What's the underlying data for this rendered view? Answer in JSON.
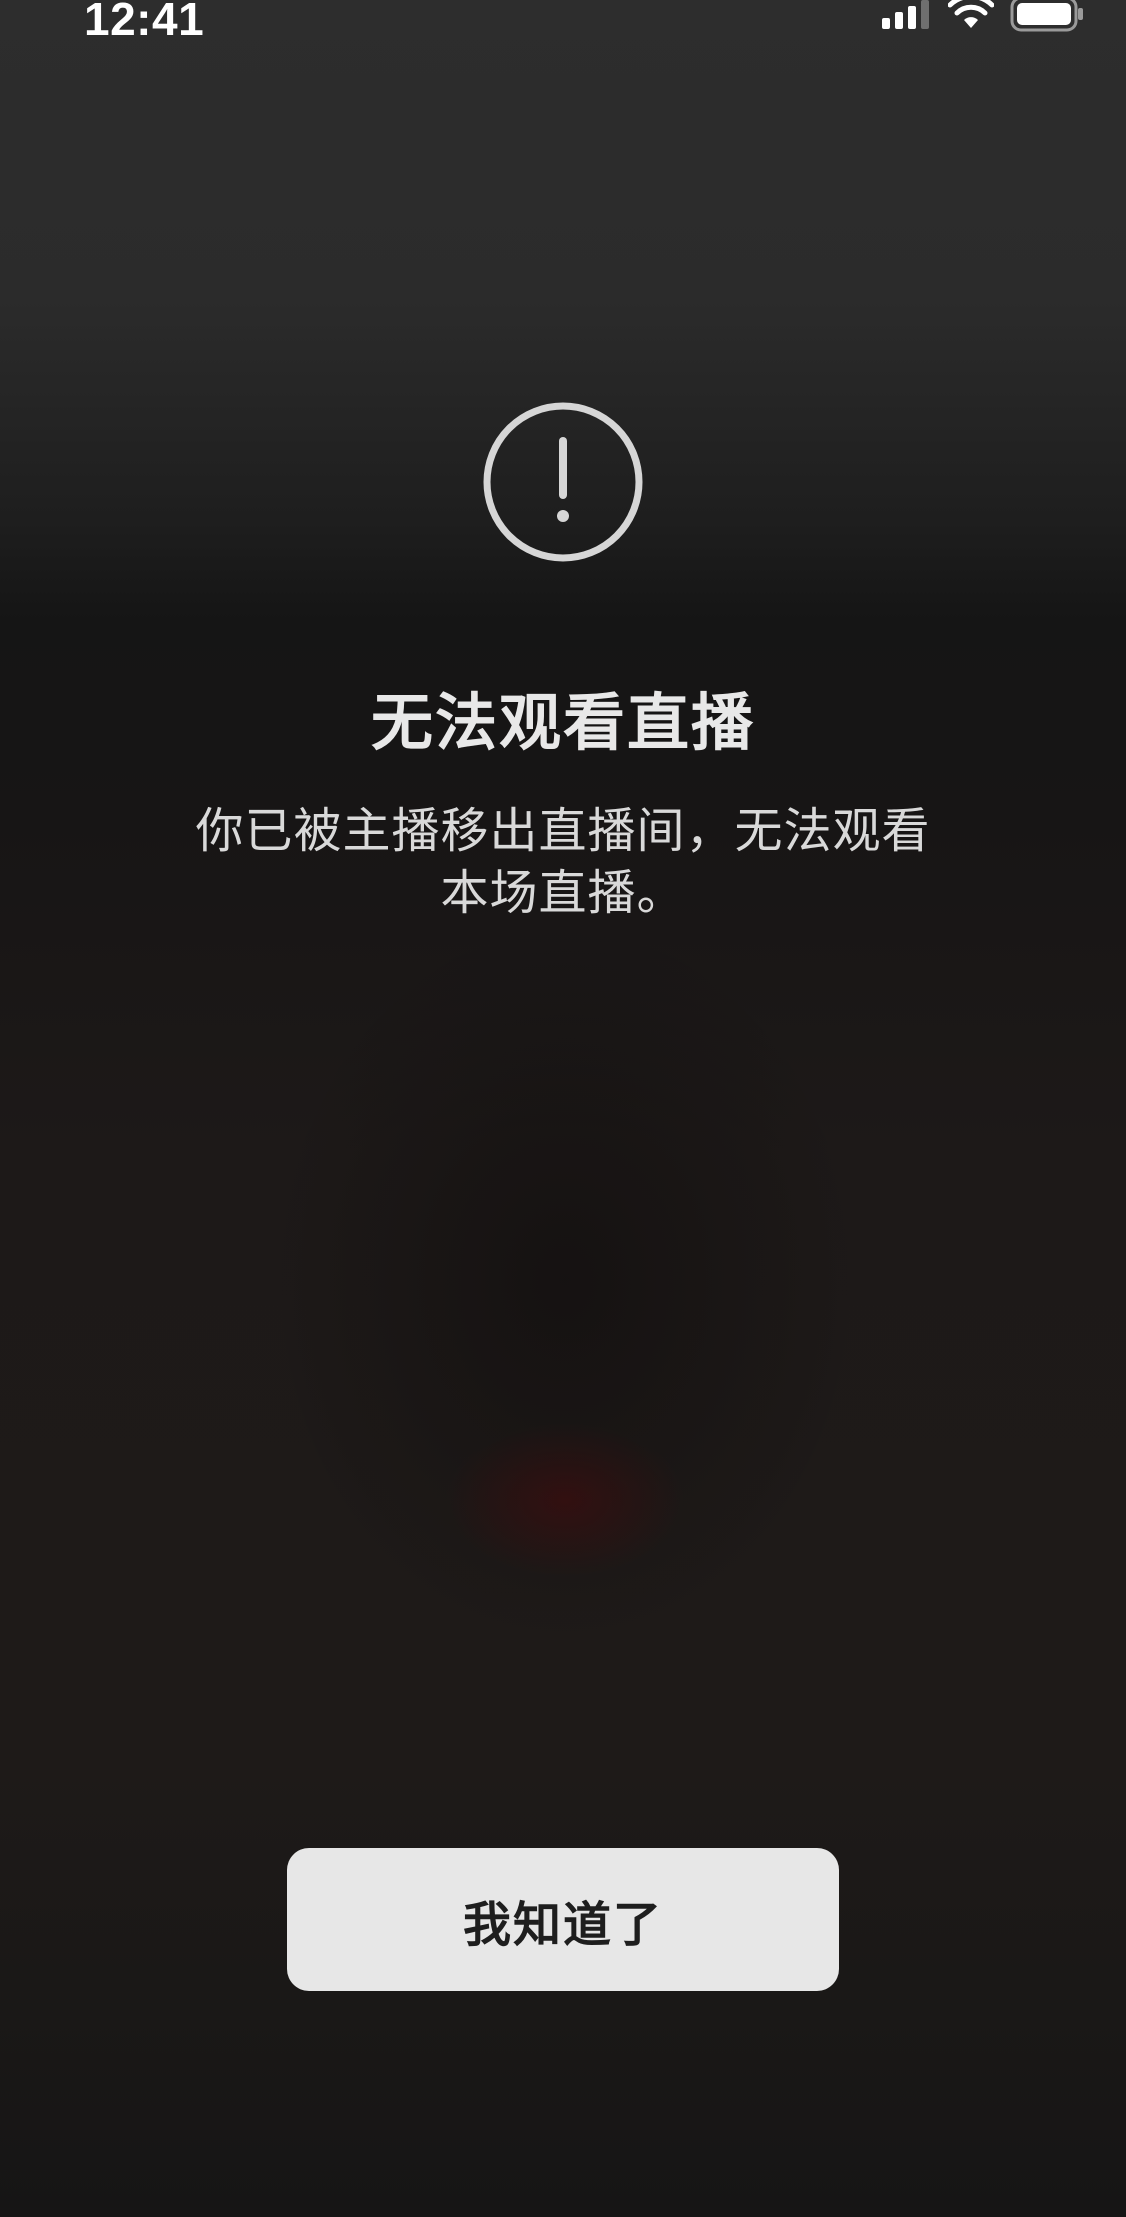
{
  "status_bar": {
    "time": "12:41",
    "icons": [
      "cellular-signal-icon",
      "wifi-icon",
      "battery-icon"
    ]
  },
  "dialog": {
    "icon": "exclamation-circle-icon",
    "title": "无法观看直播",
    "message_line1": "你已被主播移出直播间，无法观看",
    "message_line2": "本场直播。",
    "button_label": "我知道了"
  },
  "colors": {
    "background_top": "#2d2d2d",
    "background_bottom": "#1b1817",
    "title_text": "#e8e8e8",
    "button_background": "#e7e7e7",
    "button_text": "#1e1e1e",
    "icon_stroke": "#d6d6d6"
  }
}
